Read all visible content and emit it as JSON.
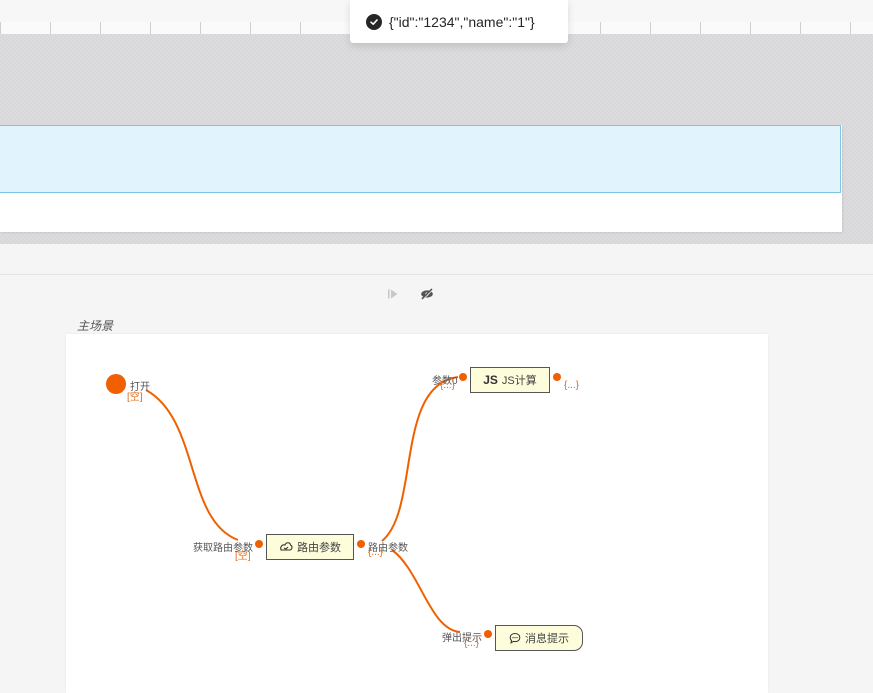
{
  "toast": {
    "message": "{\"id\":\"1234\",\"name\":\"1\"}"
  },
  "toolbar": {
    "run_icon": "step-run-icon",
    "hide_icon": "eye-slash-icon"
  },
  "scene": {
    "title": "主场景"
  },
  "flow": {
    "start": {
      "label": "打开",
      "value": "[空]"
    },
    "route_input": {
      "label": "获取路由参数",
      "value": "[空]"
    },
    "route_node": {
      "label": "路由参数",
      "icon": "route-icon"
    },
    "route_output": {
      "label": "路由参数",
      "value": "{...}"
    },
    "js_input": {
      "label": "参数0",
      "value": "{...}"
    },
    "js_node": {
      "label": "JS计算",
      "badge": "JS"
    },
    "js_output": {
      "value": "{...}"
    },
    "msg_input": {
      "label": "弹出提示",
      "value": "{...}"
    },
    "msg_node": {
      "label": "消息提示",
      "icon": "message-icon"
    }
  },
  "colors": {
    "accent": "#f06000",
    "node_bg": "#fdfcdb",
    "selection": "#e1f4fd"
  }
}
